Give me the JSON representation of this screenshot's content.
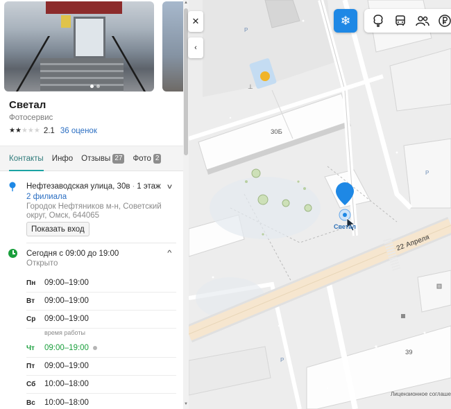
{
  "org": {
    "name": "Светал",
    "category": "Фотосервис",
    "rating": 2.1,
    "rating_text": "2.1",
    "stars_filled": 2,
    "stars_total": 5,
    "reviews_link": "36 оценок"
  },
  "tabs": [
    {
      "label": "Контакты",
      "badge": ""
    },
    {
      "label": "Инфо",
      "badge": ""
    },
    {
      "label": "Отзывы",
      "badge": "27"
    },
    {
      "label": "Фото",
      "badge": "2"
    }
  ],
  "address": {
    "street": "Нефтезаводская улица, 30в",
    "floor": "1 этаж",
    "branches_link": "2 филиала",
    "district": "Городок Нефтяников м-н, Советский округ, Омск, 644065",
    "entry_button": "Показать вход"
  },
  "hours": {
    "today": "Сегодня с 09:00 до 19:00",
    "status": "Открыто",
    "today_note": "время работы",
    "days": [
      {
        "day": "Пн",
        "time": "09:00–19:00"
      },
      {
        "day": "Вт",
        "time": "09:00–19:00"
      },
      {
        "day": "Ср",
        "time": "09:00–19:00"
      },
      {
        "day": "Чт",
        "time": "09:00–19:00"
      },
      {
        "day": "Пт",
        "time": "09:00–19:00"
      },
      {
        "day": "Сб",
        "time": "10:00–18:00"
      },
      {
        "day": "Вс",
        "time": "10:00–18:00"
      }
    ]
  },
  "map": {
    "street_label": "22 Апреля",
    "house_30b": "30Б",
    "house_39": "39",
    "pin_label": "Светал",
    "license": "Лицензионное соглаше",
    "controls": {
      "close": "✕",
      "collapse": "‹",
      "winter": "❄"
    },
    "accent_color": "#1e88e5",
    "open_color": "#1a9f3c",
    "link_color": "#2a6ec2"
  }
}
